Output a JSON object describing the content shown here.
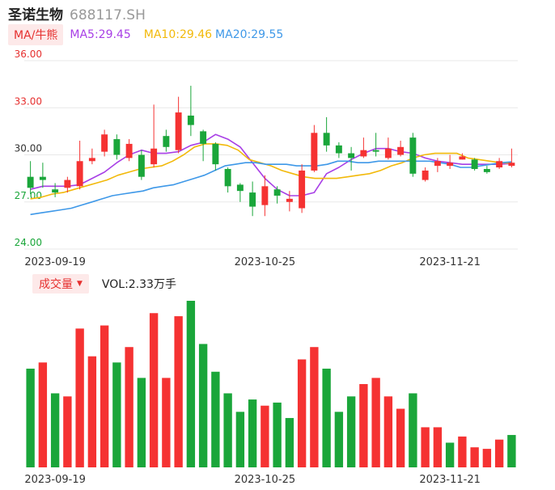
{
  "header": {
    "name": "圣诺生物",
    "code": "688117.SH"
  },
  "ma_legend": {
    "tag": "MA/牛熊",
    "items": [
      {
        "label": "MA5:",
        "value": "29.45",
        "color": "#a83fe6"
      },
      {
        "label": "MA10:",
        "value": "29.46",
        "color": "#f2b90a"
      },
      {
        "label": "MA20:",
        "value": "29.55",
        "color": "#3e98e8"
      }
    ]
  },
  "volume_legend": {
    "tag": "成交量",
    "label": "VOL:",
    "value": "2.33万手"
  },
  "colors": {
    "up": "#f53232",
    "down": "#1aa63a",
    "grid": "#e8e8e8",
    "up_axis": "#e6302f",
    "down_axis": "#1aa63a",
    "mid_axis": "#333333"
  },
  "chart_data": [
    {
      "type": "candlestick",
      "y_ticks": [
        "36.00",
        "33.00",
        "30.00",
        "27.00",
        "24.00"
      ],
      "ylim": [
        24,
        36
      ],
      "x_tick_labels": [
        {
          "label": "2023-09-19",
          "index": 2
        },
        {
          "label": "2023-10-25",
          "index": 19
        },
        {
          "label": "2023-11-21",
          "index": 34
        }
      ],
      "candles": [
        {
          "o": 28.6,
          "c": 27.9,
          "h": 29.6,
          "l": 27.5
        },
        {
          "o": 28.6,
          "c": 28.4,
          "h": 29.5,
          "l": 27.9
        },
        {
          "o": 27.8,
          "c": 27.6,
          "h": 28.2,
          "l": 27.3
        },
        {
          "o": 27.9,
          "c": 28.4,
          "h": 28.6,
          "l": 27.6
        },
        {
          "o": 28.0,
          "c": 29.6,
          "h": 30.9,
          "l": 27.8
        },
        {
          "o": 29.6,
          "c": 29.8,
          "h": 30.4,
          "l": 29.4
        },
        {
          "o": 30.2,
          "c": 31.3,
          "h": 31.6,
          "l": 29.9
        },
        {
          "o": 31.0,
          "c": 30.0,
          "h": 31.3,
          "l": 29.7
        },
        {
          "o": 29.8,
          "c": 30.7,
          "h": 31.0,
          "l": 29.6
        },
        {
          "o": 30.0,
          "c": 28.6,
          "h": 30.3,
          "l": 28.4
        },
        {
          "o": 29.4,
          "c": 30.4,
          "h": 33.2,
          "l": 29.2
        },
        {
          "o": 31.2,
          "c": 30.5,
          "h": 31.6,
          "l": 30.2
        },
        {
          "o": 30.3,
          "c": 32.7,
          "h": 33.7,
          "l": 30.1
        },
        {
          "o": 32.5,
          "c": 31.9,
          "h": 34.4,
          "l": 31.2
        },
        {
          "o": 31.5,
          "c": 30.7,
          "h": 31.6,
          "l": 29.6
        },
        {
          "o": 30.7,
          "c": 29.4,
          "h": 30.8,
          "l": 29.0
        },
        {
          "o": 29.1,
          "c": 28.0,
          "h": 29.2,
          "l": 27.6
        },
        {
          "o": 28.1,
          "c": 27.7,
          "h": 28.2,
          "l": 27.0
        },
        {
          "o": 27.6,
          "c": 26.7,
          "h": 28.3,
          "l": 26.1
        },
        {
          "o": 26.8,
          "c": 28.0,
          "h": 28.7,
          "l": 26.1
        },
        {
          "o": 27.8,
          "c": 27.4,
          "h": 28.0,
          "l": 26.9
        },
        {
          "o": 27.0,
          "c": 27.2,
          "h": 27.7,
          "l": 26.4
        },
        {
          "o": 26.6,
          "c": 29.0,
          "h": 29.4,
          "l": 26.3
        },
        {
          "o": 29.0,
          "c": 31.4,
          "h": 31.9,
          "l": 28.9
        },
        {
          "o": 31.4,
          "c": 30.6,
          "h": 32.4,
          "l": 30.2
        },
        {
          "o": 30.6,
          "c": 30.1,
          "h": 30.8,
          "l": 29.8
        },
        {
          "o": 30.1,
          "c": 29.8,
          "h": 30.5,
          "l": 29.0
        },
        {
          "o": 29.9,
          "c": 30.3,
          "h": 31.1,
          "l": 29.8
        },
        {
          "o": 30.3,
          "c": 30.2,
          "h": 31.4,
          "l": 29.9
        },
        {
          "o": 29.8,
          "c": 30.4,
          "h": 31.1,
          "l": 29.7
        },
        {
          "o": 30.0,
          "c": 30.5,
          "h": 30.9,
          "l": 29.9
        },
        {
          "o": 31.1,
          "c": 28.8,
          "h": 31.4,
          "l": 28.6
        },
        {
          "o": 28.4,
          "c": 29.0,
          "h": 29.2,
          "l": 28.3
        },
        {
          "o": 29.3,
          "c": 29.6,
          "h": 29.8,
          "l": 28.9
        },
        {
          "o": 29.3,
          "c": 29.5,
          "h": 30.0,
          "l": 29.1
        },
        {
          "o": 29.7,
          "c": 29.9,
          "h": 30.1,
          "l": 29.7
        },
        {
          "o": 29.7,
          "c": 29.1,
          "h": 29.8,
          "l": 29.0
        },
        {
          "o": 29.1,
          "c": 28.9,
          "h": 29.3,
          "l": 28.8
        },
        {
          "o": 29.2,
          "c": 29.6,
          "h": 29.8,
          "l": 29.1
        },
        {
          "o": 29.3,
          "c": 29.5,
          "h": 30.4,
          "l": 29.2
        }
      ],
      "series": [
        {
          "name": "MA5",
          "color": "#a83fe6",
          "values": [
            27.8,
            28.0,
            28.0,
            28.0,
            28.1,
            28.5,
            28.9,
            29.5,
            30.0,
            30.3,
            30.1,
            30.1,
            30.2,
            30.6,
            30.8,
            31.3,
            31.0,
            30.5,
            29.5,
            28.5,
            27.8,
            27.4,
            27.4,
            27.6,
            28.8,
            29.2,
            29.7,
            30.1,
            30.4,
            30.4,
            30.2,
            30.1,
            29.8,
            29.6,
            29.5,
            29.4,
            29.4,
            29.4,
            29.4,
            29.45
          ]
        },
        {
          "name": "MA10",
          "color": "#f2b90a",
          "values": [
            27.2,
            27.3,
            27.5,
            27.6,
            27.8,
            28.0,
            28.2,
            28.4,
            28.7,
            28.9,
            29.1,
            29.2,
            29.3,
            29.6,
            30.0,
            30.5,
            30.7,
            30.7,
            30.6,
            30.3,
            29.7,
            29.5,
            29.3,
            29.0,
            28.8,
            28.6,
            28.5,
            28.5,
            28.5,
            28.6,
            28.7,
            28.8,
            29.0,
            29.3,
            29.5,
            29.8,
            30.0,
            30.1,
            30.1,
            30.1,
            29.8,
            29.7,
            29.6,
            29.5,
            29.46
          ]
        },
        {
          "name": "MA20",
          "color": "#3e98e8",
          "values": [
            26.2,
            26.3,
            26.4,
            26.5,
            26.6,
            26.8,
            27.0,
            27.2,
            27.4,
            27.5,
            27.6,
            27.7,
            27.9,
            28.0,
            28.1,
            28.3,
            28.5,
            28.7,
            29.0,
            29.3,
            29.4,
            29.5,
            29.5,
            29.4,
            29.4,
            29.4,
            29.3,
            29.3,
            29.3,
            29.4,
            29.6,
            29.6,
            29.5,
            29.5,
            29.6,
            29.6,
            29.6,
            29.6,
            29.6,
            29.6,
            29.5,
            29.4,
            29.2,
            29.2,
            29.3,
            29.4,
            29.5,
            29.55
          ]
        }
      ]
    },
    {
      "type": "bar",
      "name": "成交量",
      "values": [
        3.2,
        3.4,
        2.4,
        2.3,
        4.5,
        3.6,
        4.6,
        3.4,
        3.9,
        2.9,
        5.0,
        2.9,
        4.9,
        5.4,
        4.0,
        3.1,
        2.4,
        1.8,
        2.2,
        2.0,
        2.1,
        1.6,
        3.5,
        3.9,
        3.2,
        1.8,
        2.3,
        2.7,
        2.9,
        2.3,
        1.9,
        2.4,
        1.3,
        1.3,
        0.8,
        1.0,
        0.65,
        0.6,
        0.9,
        1.05
      ],
      "directions": [
        "down",
        "up",
        "down",
        "up",
        "up",
        "up",
        "up",
        "down",
        "up",
        "down",
        "up",
        "up",
        "up",
        "down",
        "down",
        "down",
        "down",
        "down",
        "down",
        "up",
        "down",
        "down",
        "up",
        "up",
        "down",
        "down",
        "down",
        "up",
        "up",
        "up",
        "up",
        "down",
        "up",
        "up",
        "down",
        "up",
        "up",
        "up",
        "up",
        "down"
      ],
      "x_tick_labels": [
        "2023-09-19",
        "2023-10-25",
        "2023-11-21"
      ]
    }
  ]
}
